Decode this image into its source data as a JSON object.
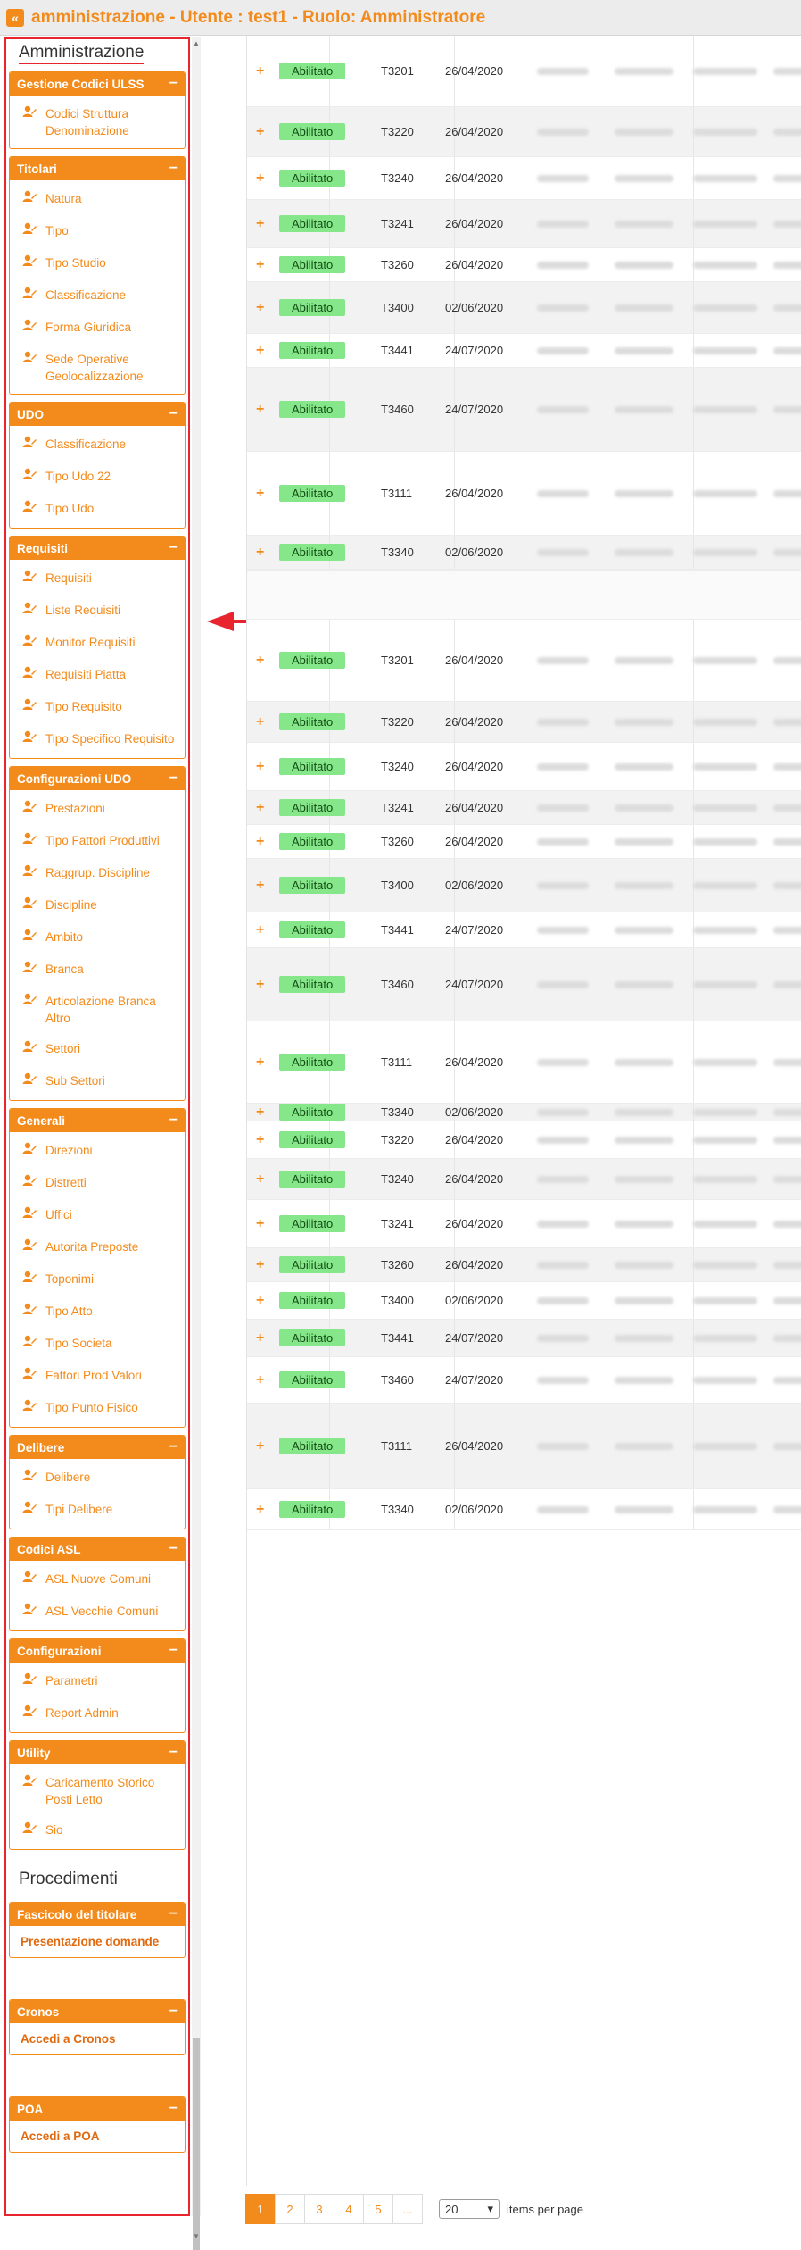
{
  "window": {
    "title": "amministrazione - Utente : test1 - Ruolo: Amministratore",
    "back_icon": "double-chevron-left-icon"
  },
  "sidebar": {
    "heading": "Amministrazione",
    "heading2": "Procedimenti",
    "groups": [
      {
        "title": "Gestione Codici ULSS",
        "items": [
          "Codici Struttura Denominazione"
        ]
      },
      {
        "title": "Titolari",
        "items": [
          "Natura",
          "Tipo",
          "Tipo Studio",
          "Classificazione",
          "Forma Giuridica",
          "Sede Operative Geolocalizzazione"
        ]
      },
      {
        "title": "UDO",
        "items": [
          "Classificazione",
          "Tipo Udo 22",
          "Tipo Udo"
        ]
      },
      {
        "title": "Requisiti",
        "items": [
          "Requisiti",
          "Liste Requisiti",
          "Monitor Requisiti",
          "Requisiti Piatta",
          "Tipo Requisito",
          "Tipo Specifico Requisito"
        ]
      },
      {
        "title": "Configurazioni UDO",
        "items": [
          "Prestazioni",
          "Tipo Fattori Produttivi",
          "Raggrup. Discipline",
          "Discipline",
          "Ambito",
          "Branca",
          "Articolazione Branca Altro",
          "Settori",
          "Sub Settori"
        ]
      },
      {
        "title": "Generali",
        "items": [
          "Direzioni",
          "Distretti",
          "Uffici",
          "Autorita Preposte",
          "Toponimi",
          "Tipo Atto",
          "Tipo Societa",
          "Fattori Prod Valori",
          "Tipo Punto Fisico"
        ]
      },
      {
        "title": "Delibere",
        "items": [
          "Delibere",
          "Tipi Delibere"
        ]
      },
      {
        "title": "Codici ASL",
        "items": [
          "ASL Nuove Comuni",
          "ASL Vecchie Comuni"
        ]
      },
      {
        "title": "Configurazioni",
        "items": [
          "Parametri",
          "Report Admin"
        ]
      },
      {
        "title": "Utility",
        "items": [
          "Caricamento Storico Posti Letto",
          "Sio"
        ]
      }
    ],
    "proc_groups": [
      {
        "title": "Fascicolo del titolare",
        "link": "Presentazione domande"
      },
      {
        "title": "Cronos",
        "link": "Accedi a Cronos"
      },
      {
        "title": "POA",
        "link": "Accedi a POA"
      }
    ],
    "collapse_symbol": "−",
    "item_icon": "user-edit-icon"
  },
  "table": {
    "expand_symbol": "+",
    "rows": [
      {
        "status": "Abilitato",
        "code": "T3201",
        "date": "26/04/2020"
      },
      {
        "status": "Abilitato",
        "code": "T3220",
        "date": "26/04/2020"
      },
      {
        "status": "Abilitato",
        "code": "T3240",
        "date": "26/04/2020"
      },
      {
        "status": "Abilitato",
        "code": "T3241",
        "date": "26/04/2020"
      },
      {
        "status": "Abilitato",
        "code": "T3260",
        "date": "26/04/2020"
      },
      {
        "status": "Abilitato",
        "code": "T3400",
        "date": "02/06/2020"
      },
      {
        "status": "Abilitato",
        "code": "T3441",
        "date": "24/07/2020"
      },
      {
        "status": "Abilitato",
        "code": "T3460",
        "date": "24/07/2020"
      },
      {
        "status": "Abilitato",
        "code": "T3111",
        "date": "26/04/2020"
      },
      {
        "status": "Abilitato",
        "code": "T3340",
        "date": "02/06/2020"
      },
      {
        "status": "Abilitato",
        "code": "T3201",
        "date": "26/04/2020"
      },
      {
        "status": "Abilitato",
        "code": "T3220",
        "date": "26/04/2020"
      },
      {
        "status": "Abilitato",
        "code": "T3240",
        "date": "26/04/2020"
      },
      {
        "status": "Abilitato",
        "code": "T3241",
        "date": "26/04/2020"
      },
      {
        "status": "Abilitato",
        "code": "T3260",
        "date": "26/04/2020"
      },
      {
        "status": "Abilitato",
        "code": "T3400",
        "date": "02/06/2020"
      },
      {
        "status": "Abilitato",
        "code": "T3441",
        "date": "24/07/2020"
      },
      {
        "status": "Abilitato",
        "code": "T3460",
        "date": "24/07/2020"
      },
      {
        "status": "Abilitato",
        "code": "T3111",
        "date": "26/04/2020"
      },
      {
        "status": "Abilitato",
        "code": "T3340",
        "date": "02/06/2020"
      },
      {
        "status": "Abilitato",
        "code": "T3220",
        "date": "26/04/2020"
      },
      {
        "status": "Abilitato",
        "code": "T3240",
        "date": "26/04/2020"
      },
      {
        "status": "Abilitato",
        "code": "T3241",
        "date": "26/04/2020"
      },
      {
        "status": "Abilitato",
        "code": "T3260",
        "date": "26/04/2020"
      },
      {
        "status": "Abilitato",
        "code": "T3400",
        "date": "02/06/2020"
      },
      {
        "status": "Abilitato",
        "code": "T3441",
        "date": "24/07/2020"
      },
      {
        "status": "Abilitato",
        "code": "T3460",
        "date": "24/07/2020"
      },
      {
        "status": "Abilitato",
        "code": "T3111",
        "date": "26/04/2020"
      },
      {
        "status": "Abilitato",
        "code": "T3340",
        "date": "02/06/2020"
      }
    ]
  },
  "pagination": {
    "pages": [
      "1",
      "2",
      "3",
      "4",
      "5",
      "..."
    ],
    "active_page": "1",
    "page_size": "20",
    "page_size_label": "items per page"
  },
  "colors": {
    "accent": "#f38b1c",
    "annotation": "#e8242e",
    "status_green": "#86e68a"
  }
}
